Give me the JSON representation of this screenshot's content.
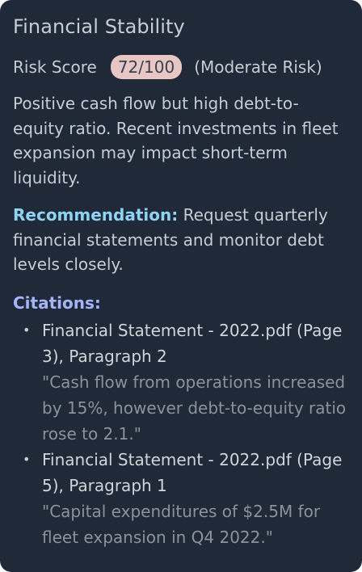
{
  "card": {
    "title": "Financial Stability",
    "risk_label": "Risk Score",
    "risk_score": "72/100",
    "risk_level": "(Moderate Risk)",
    "summary": "Positive cash flow but high debt-to-equity ratio. Recent investments in fleet expansion may impact short-term liquidity.",
    "recommendation_label": "Recommendation:",
    "recommendation_text": " Request quarterly financial statements and monitor debt levels closely.",
    "citations_title": "Citations:",
    "citations": [
      {
        "source": "Financial Statement - 2022.pdf (Page 3), Paragraph 2",
        "quote": "\"Cash flow from operations increased by 15%, however debt-to-equity ratio rose to 2.1.\""
      },
      {
        "source": "Financial Statement - 2022.pdf (Page 5), Paragraph 1",
        "quote": "\"Capital expenditures of $2.5M for fleet expansion in Q4 2022.\""
      }
    ]
  },
  "colors": {
    "card_background": "#1f2937",
    "badge_background": "#e8c6c4",
    "recommendation_accent": "#8fd3f4",
    "citations_accent": "#a5b4fc"
  }
}
